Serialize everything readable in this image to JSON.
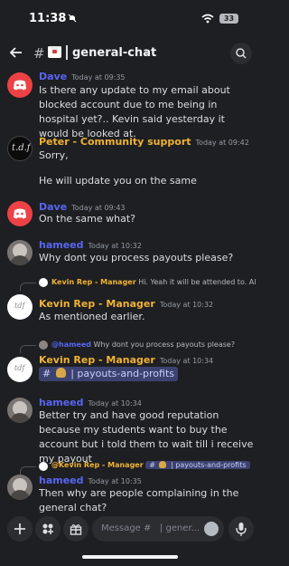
{
  "status": {
    "time": "11:38",
    "battery": "33"
  },
  "header": {
    "hash": "#",
    "channel": "general-chat",
    "chevron": "›"
  },
  "messages": [
    {
      "author": "Dave",
      "color": "#5865f2",
      "time": "Today at 09:35",
      "text": "Is there any update to my email about blocked account due to me being in hospital yet?.. Kevin said yesterday it would be looked at."
    },
    {
      "author": "Peter - Community support",
      "color": "#f0b232",
      "time": "Today at 09:42",
      "text_lines": [
        "Sorry,",
        "He will update you on the same"
      ]
    },
    {
      "author": "Dave",
      "color": "#5865f2",
      "time": "Today at 09:43",
      "text": "On the same what?"
    },
    {
      "author": "hameed",
      "color": "#5865f2",
      "time": "Today at 10:32",
      "text": "Why dont you process payouts please?"
    },
    {
      "author": "Kevin Rep - Manager",
      "color": "#f0b232",
      "time": "Today at 10:32",
      "reply": {
        "name": "Kevin Rep - Manager",
        "text": "Hi. Yeah it will be attended to. All issues and queries are being attended to one by one and fa..."
      },
      "text": "As mentioned earlier."
    },
    {
      "author": "Kevin Rep - Manager",
      "color": "#f0b232",
      "time": "Today at 10:34",
      "reply": {
        "name": "@hameed",
        "text": "Why dont you process payouts please?"
      },
      "channel_mention": {
        "hash": "#",
        "name": "| payouts-and-profits"
      }
    },
    {
      "author": "hameed",
      "color": "#5865f2",
      "time": "Today at 10:34",
      "text": "Better try and have good reputation because my students want to buy the account but i told them to wait till i receive my payout"
    },
    {
      "author": "hameed",
      "color": "#5865f2",
      "time": "Today at 10:35",
      "reply": {
        "name": "@Kevin Rep - Manager",
        "mention_hash": "#",
        "mention_channel": "| payouts-and-profits"
      },
      "text": "Then why are people complaining in the general chat?"
    }
  ],
  "composer": {
    "placeholder": "Message #   | gener..."
  },
  "avatars": {
    "peter_initials": "t.d.f"
  }
}
